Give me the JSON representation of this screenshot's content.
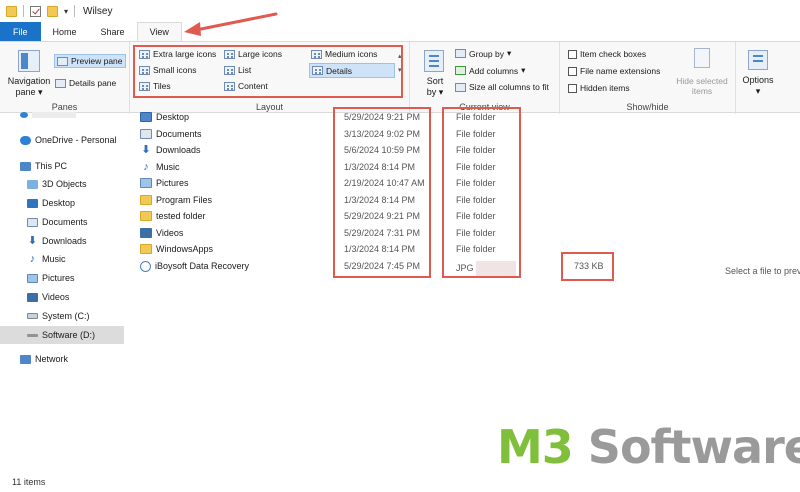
{
  "window": {
    "title": "Wilsey"
  },
  "tabs": [
    {
      "label": "File"
    },
    {
      "label": "Home"
    },
    {
      "label": "Share"
    },
    {
      "label": "View"
    }
  ],
  "ribbon": {
    "panes": {
      "navigation_label": "Navigation",
      "navigation_label2": "pane",
      "preview_label": "Preview pane",
      "details_label": "Details pane",
      "group_label": "Panes"
    },
    "layout": {
      "extra_large_icons": "Extra large icons",
      "large_icons": "Large icons",
      "medium_icons": "Medium icons",
      "small_icons": "Small icons",
      "list": "List",
      "details": "Details",
      "tiles": "Tiles",
      "content": "Content",
      "group_label": "Layout"
    },
    "current_view": {
      "sort_label": "Sort",
      "sort_label2": "by",
      "group_by": "Group by",
      "add_columns": "Add columns",
      "size_all_columns": "Size all columns to fit",
      "group_label": "Current view"
    },
    "show_hide": {
      "item_check_boxes": "Item check boxes",
      "file_name_extensions": "File name extensions",
      "hidden_items": "Hidden items",
      "hide_selected": "Hide selected",
      "hide_selected2": "items",
      "group_label": "Show/hide"
    },
    "options": {
      "label": "Options"
    }
  },
  "nav": [
    {
      "label": "OneDrive - Personal"
    },
    {
      "label": "This PC"
    },
    {
      "label": "3D Objects"
    },
    {
      "label": "Desktop"
    },
    {
      "label": "Documents"
    },
    {
      "label": "Downloads"
    },
    {
      "label": "Music"
    },
    {
      "label": "Pictures"
    },
    {
      "label": "Videos"
    },
    {
      "label": "System (C:)"
    },
    {
      "label": "Software (D:)"
    },
    {
      "label": "Network"
    }
  ],
  "files": [
    {
      "name": "Desktop",
      "date": "5/29/2024 9:21 PM",
      "type": "File folder",
      "size": ""
    },
    {
      "name": "Documents",
      "date": "3/13/2024 9:02 PM",
      "type": "File folder",
      "size": ""
    },
    {
      "name": "Downloads",
      "date": "5/6/2024 10:59 PM",
      "type": "File folder",
      "size": ""
    },
    {
      "name": "Music",
      "date": "1/3/2024 8:14 PM",
      "type": "File folder",
      "size": ""
    },
    {
      "name": "Pictures",
      "date": "2/19/2024 10:47 AM",
      "type": "File folder",
      "size": ""
    },
    {
      "name": "Program Files",
      "date": "1/3/2024 8:14 PM",
      "type": "File folder",
      "size": ""
    },
    {
      "name": "tested folder",
      "date": "5/29/2024 9:21 PM",
      "type": "File folder",
      "size": ""
    },
    {
      "name": "Videos",
      "date": "5/29/2024 7:31 PM",
      "type": "File folder",
      "size": ""
    },
    {
      "name": "WindowsApps",
      "date": "1/3/2024 8:14 PM",
      "type": "File folder",
      "size": ""
    },
    {
      "name": "iBoysoft Data Recovery",
      "date": "5/29/2024 7:45 PM",
      "type": "JPG",
      "size": "733 KB"
    }
  ],
  "preview_hint": "Select a file to prev",
  "status": {
    "items": "11 items"
  },
  "watermark": {
    "part1": "M3",
    "part2": " Software"
  },
  "colors": {
    "file_tab": "#1a73c8",
    "annotation": "#e05a4f",
    "watermark_green": "#7fbf3c"
  }
}
